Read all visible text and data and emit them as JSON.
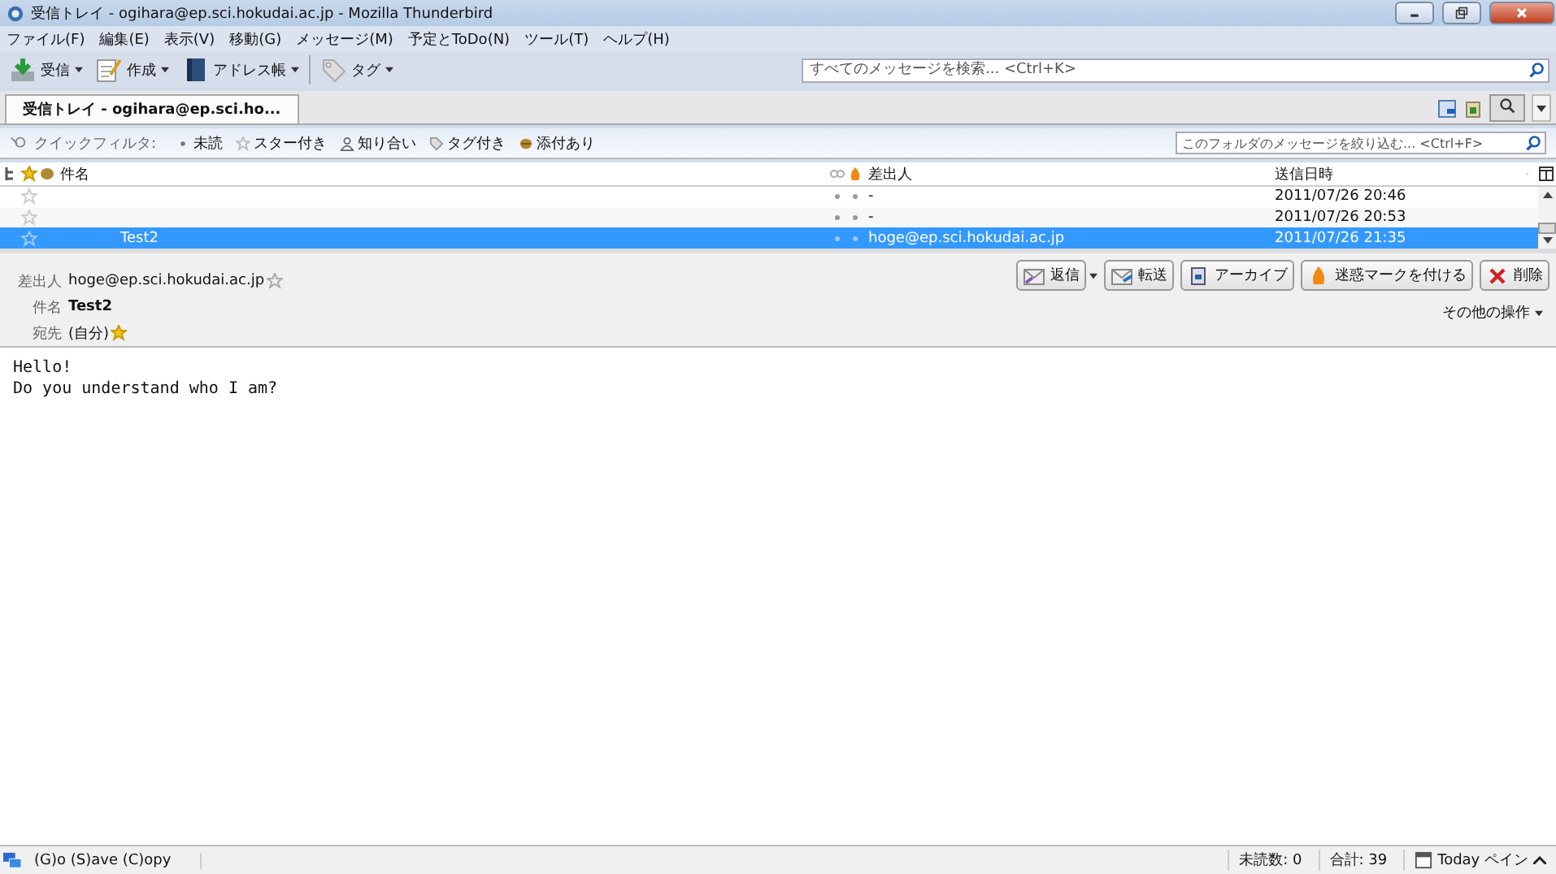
{
  "window": {
    "title": "受信トレイ - ogihara@ep.sci.hokudai.ac.jp - Mozilla Thunderbird"
  },
  "menu": [
    "ファイル(F)",
    "編集(E)",
    "表示(V)",
    "移動(G)",
    "メッセージ(M)",
    "予定とToDo(N)",
    "ツール(T)",
    "ヘルプ(H)"
  ],
  "toolbar": [
    {
      "kind": "get",
      "label": "受信"
    },
    {
      "kind": "write",
      "label": "作成"
    },
    {
      "kind": "book",
      "label": "アドレス帳"
    },
    {
      "kind": "tag",
      "label": "タグ"
    }
  ],
  "search": {
    "placeholder": "すべてのメッセージを検索... <Ctrl+K>"
  },
  "tabs": [
    {
      "label": "受信トレイ - ogihara@ep.sci.ho...",
      "selected": true
    }
  ],
  "quick_filter": {
    "label": "クイックフィルタ:",
    "buttons": [
      {
        "kind": "unread",
        "label": "未読"
      },
      {
        "kind": "star",
        "label": "スター付き"
      },
      {
        "kind": "contact",
        "label": "知り合い"
      },
      {
        "kind": "tag",
        "label": "タグ付き"
      },
      {
        "kind": "attach",
        "label": "添付あり"
      }
    ],
    "placeholder": "このフォルダのメッセージを絞り込む... <Ctrl+F>"
  },
  "table": {
    "columns": [
      "件名",
      "差出人",
      "送信日時"
    ],
    "rows": [
      {
        "sender": "-",
        "date": "2011/07/26 20:46",
        "selected": false
      },
      {
        "sender": "-",
        "date": "2011/07/26 20:53",
        "selected": false
      },
      {
        "subject": "Test2",
        "sender": "hoge@ep.sci.hokudai.ac.jp",
        "date": "2011/07/26 21:35",
        "selected": true
      }
    ]
  },
  "header": {
    "fields": [
      {
        "label": "差出人",
        "value": "hoge@ep.sci.hokudai.ac.jp",
        "kind": "from"
      },
      {
        "label": "件名",
        "value": "Test2",
        "kind": "subject"
      },
      {
        "label": "宛先",
        "value": "(自分)",
        "kind": "to"
      }
    ],
    "buttons": [
      {
        "kind": "reply",
        "label": "返信"
      },
      {
        "kind": "forward",
        "label": "転送"
      },
      {
        "kind": "archive",
        "label": "アーカイブ"
      },
      {
        "kind": "junk",
        "label": "迷惑マークを付ける"
      },
      {
        "kind": "delete",
        "label": "削除"
      }
    ],
    "more": "その他の操作"
  },
  "body": [
    "Hello!",
    "Do you understand who I am?"
  ],
  "status_bar": {
    "text": "(G)o (S)ave (C)opy",
    "unread": "未読数: 0",
    "total": "合計: 39",
    "today": "Today ペイン"
  }
}
